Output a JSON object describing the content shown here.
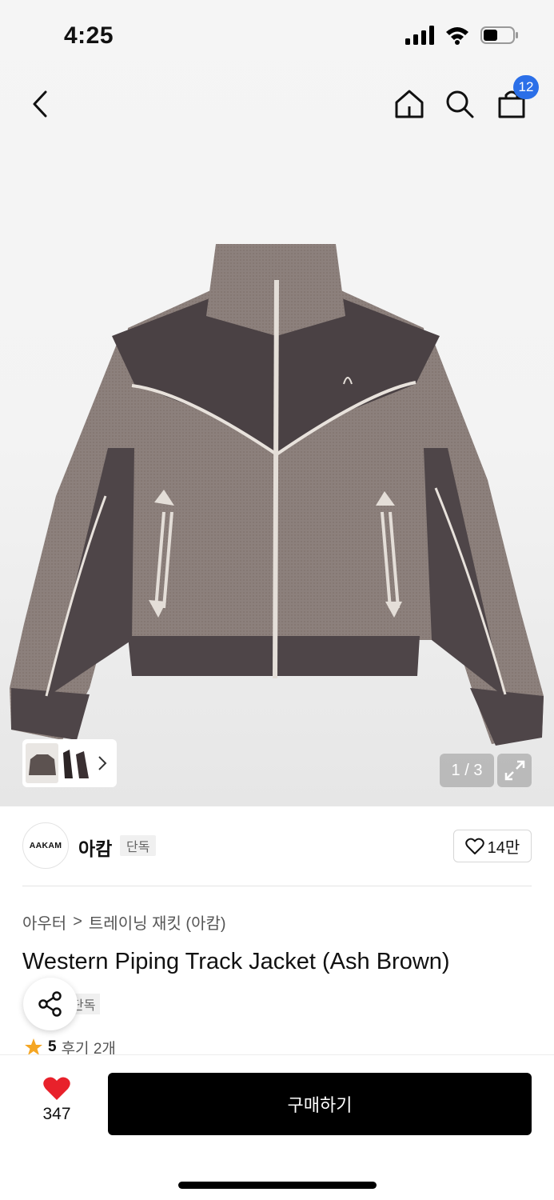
{
  "status_bar": {
    "time": "4:25"
  },
  "nav": {
    "cart_count": "12"
  },
  "gallery": {
    "page_indicator": "1 / 3"
  },
  "brand": {
    "logo_text": "AAKAM",
    "name": "아캄",
    "tag": "단독",
    "like_count": "14만"
  },
  "breadcrumb": {
    "category": "아우터",
    "separator": ">",
    "subcategory": "트레이닝 재킷 (아캄)"
  },
  "product": {
    "title": "Western Piping Track Jacket (Ash Brown)",
    "tag": "단독",
    "rating": "5",
    "reviews": "후기 2개"
  },
  "bottom": {
    "wish_count": "347",
    "buy_label": "구매하기"
  },
  "colors": {
    "accent_blue": "#2b6fe8",
    "heart_red": "#e8212b",
    "star": "#f5a623",
    "jacket_knit": "#8a7d7a",
    "jacket_velvet": "#4e4548"
  }
}
